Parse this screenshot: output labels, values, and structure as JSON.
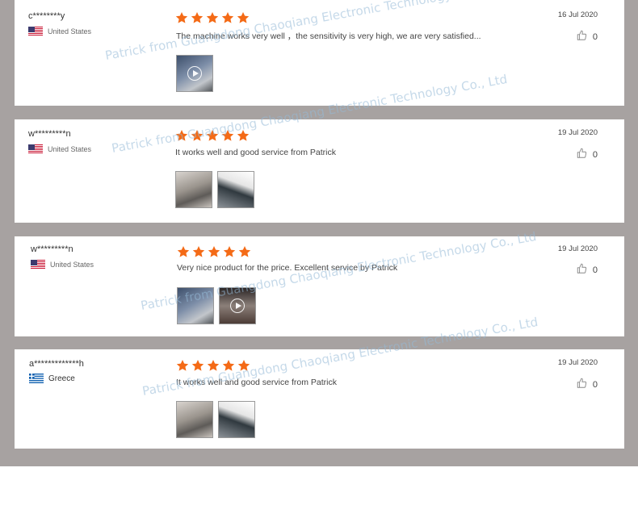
{
  "watermark": "Patrick from Guangdong Chaoqiang Electronic Technology Co., Ltd",
  "colors": {
    "star": "#f46a16",
    "background": "#a7a2a1"
  },
  "reviews": [
    {
      "user": "c********y",
      "country": "United States",
      "flag": "us-flag-icon",
      "rating": 5,
      "text": "The machine works very well ，the sensitivity is very high, we are very satisfied...",
      "date": "16 Jul 2020",
      "likes": "0",
      "photos": 1
    },
    {
      "user": "w*********n",
      "country": "United States",
      "flag": "us-flag-icon",
      "rating": 5,
      "text": "It works well and good service from Patrick",
      "date": "19 Jul 2020",
      "likes": "0",
      "photos": 2
    },
    {
      "user": "w*********n",
      "country": "United States",
      "flag": "us-flag-icon",
      "rating": 5,
      "text": "Very nice product for the price. Excellent service by Patrick",
      "date": "19 Jul 2020",
      "likes": "0",
      "photos": 2
    },
    {
      "user": "a*************h",
      "country": "Greece",
      "flag": "greece-flag-icon",
      "rating": 5,
      "text": "It works well and good service from Patrick",
      "date": "19 Jul 2020",
      "likes": "0",
      "photos": 2
    }
  ]
}
